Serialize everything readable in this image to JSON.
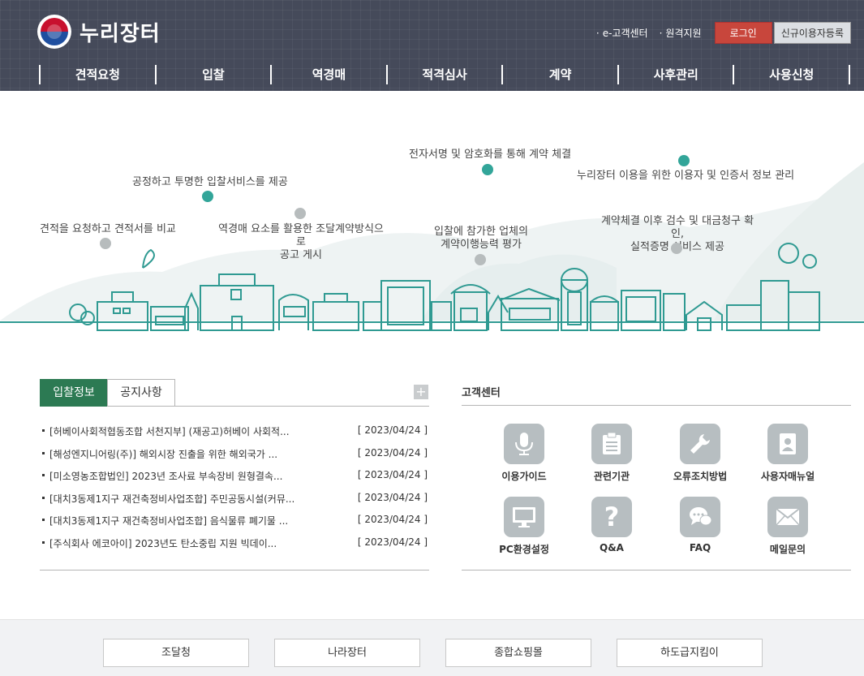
{
  "header": {
    "logo_text": "누리장터",
    "util_links": [
      "e-고객센터",
      "원격지원"
    ],
    "login_label": "로그인",
    "join_label": "신규이용자등록",
    "gnb": [
      "견적요청",
      "입찰",
      "역경매",
      "적격심사",
      "계약",
      "사후관리",
      "사용신청"
    ]
  },
  "hero": {
    "labels": {
      "quote": "견적을 요청하고 견적서를 비교",
      "bid": "공정하고 투명한 입찰서비스를 제공",
      "reverse1": "역경매 요소를 활용한 조달계약방식으로",
      "reverse2": "공고 게시",
      "sign": "전자서명 및 암호화를 통해 계약 체결",
      "eval1": "입찰에 참가한 업체의",
      "eval2": "계약이행능력 평가",
      "mgmt1": "계약체결 이후 검수 및 대금청구 확인,",
      "mgmt2": "실적증명 서비스 제공",
      "user": "누리장터 이용을 위한 이용자 및 인증서 정보 관리"
    }
  },
  "notice": {
    "tabs": [
      "입찰정보",
      "공지사항"
    ],
    "more_label": "+",
    "items": [
      {
        "title": "[허베이사회적협동조합 서천지부] (재공고)허베이 사회적...",
        "date": "[ 2023/04/24 ]"
      },
      {
        "title": "[해성엔지니어링(주)] 해외시장 진출을 위한 해외국가 ...",
        "date": "[ 2023/04/24 ]"
      },
      {
        "title": "[미소영농조합법인] 2023년 조사료 부속장비 원형결속...",
        "date": "[ 2023/04/24 ]"
      },
      {
        "title": "[대치3동제1지구 재건축정비사업조합] 주민공동시설(커뮤...",
        "date": "[ 2023/04/24 ]"
      },
      {
        "title": "[대치3동제1지구 재건축정비사업조합] 음식물류 폐기물 ...",
        "date": "[ 2023/04/24 ]"
      },
      {
        "title": "[주식회사 에코아이] 2023년도 탄소중립 지원 빅데이...",
        "date": "[ 2023/04/24 ]"
      }
    ]
  },
  "customer": {
    "title": "고객센터",
    "items": [
      {
        "label": "이용가이드",
        "icon": "microphone-icon"
      },
      {
        "label": "관련기관",
        "icon": "clipboard-icon"
      },
      {
        "label": "오류조치방법",
        "icon": "wrench-icon"
      },
      {
        "label": "사용자매뉴얼",
        "icon": "manual-book-icon"
      },
      {
        "label": "PC환경설정",
        "icon": "monitor-icon"
      },
      {
        "label": "Q&A",
        "icon": "question-icon"
      },
      {
        "label": "FAQ",
        "icon": "chat-bubbles-icon"
      },
      {
        "label": "메일문의",
        "icon": "mail-icon"
      }
    ]
  },
  "footer": {
    "links": [
      "조달청",
      "나라장터",
      "종합쇼핑몰",
      "하도급지킴이"
    ]
  }
}
